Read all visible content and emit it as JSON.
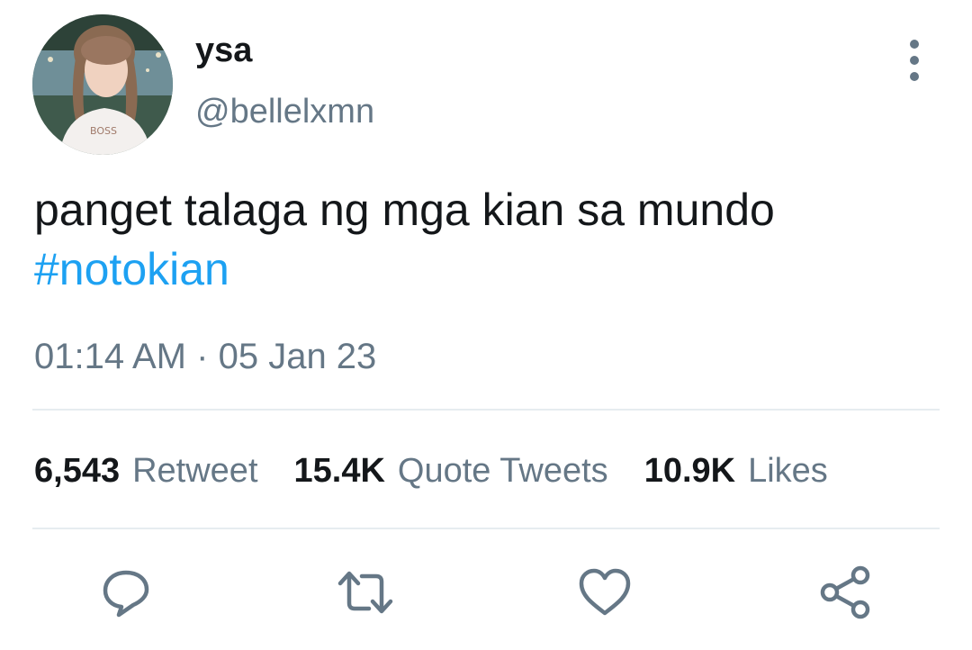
{
  "user": {
    "display_name": "ysa",
    "handle": "@bellelxmn",
    "avatar_shirt_text": "BOSS"
  },
  "tweet": {
    "text_line1": "panget talaga ng mga kian sa mundo",
    "hashtag": "#notokian",
    "time": "01:14 AM",
    "separator": "·",
    "date": "05 Jan 23"
  },
  "stats": {
    "retweets_count": "6,543",
    "retweets_label": "Retweet",
    "quotes_count": "15.4K",
    "quotes_label": "Quote Tweets",
    "likes_count": "10.9K",
    "likes_label": "Likes"
  },
  "actions": {
    "reply_icon": "reply-icon",
    "retweet_icon": "retweet-icon",
    "like_icon": "heart-icon",
    "share_icon": "share-icon"
  },
  "colors": {
    "text": "#14171a",
    "muted": "#657786",
    "link": "#1da1f2",
    "divider": "#e6ecf0"
  }
}
